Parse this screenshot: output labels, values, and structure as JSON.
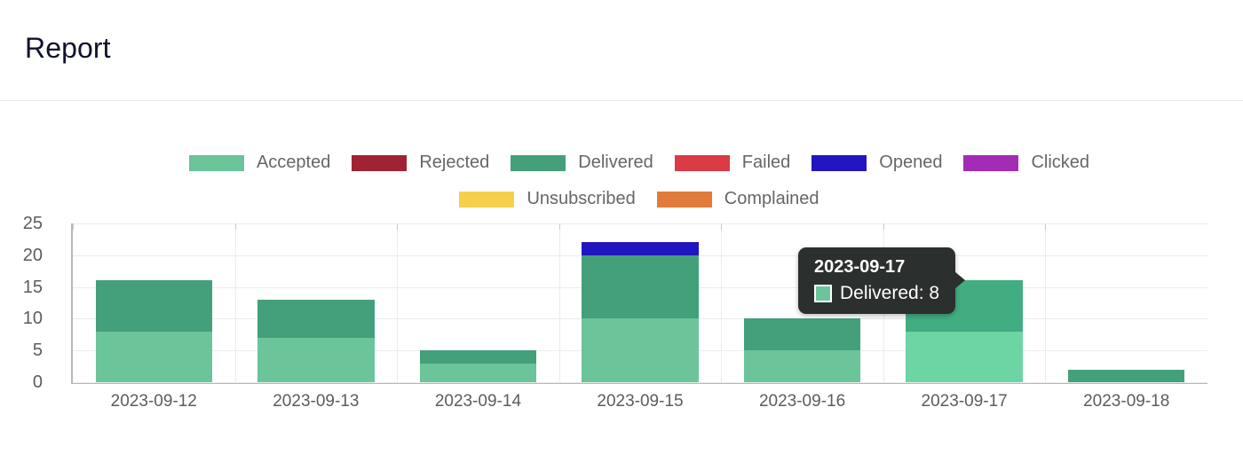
{
  "header": {
    "title": "Report"
  },
  "legend": {
    "rows": [
      [
        {
          "label": "Accepted",
          "color": "#6BC49A"
        },
        {
          "label": "Rejected",
          "color": "#A02334"
        },
        {
          "label": "Delivered",
          "color": "#43A07A"
        },
        {
          "label": "Failed",
          "color": "#DB3B45"
        },
        {
          "label": "Opened",
          "color": "#2116BF"
        },
        {
          "label": "Clicked",
          "color": "#A32BB5"
        }
      ],
      [
        {
          "label": "Unsubscribed",
          "color": "#F6D council"
        },
        {
          "label": "Complained",
          "color": "#E07B39"
        }
      ]
    ]
  },
  "chart_data": {
    "type": "bar",
    "stacked": true,
    "title": "Report",
    "xlabel": "",
    "ylabel": "",
    "ylim": [
      0,
      25
    ],
    "yticks": [
      0,
      5,
      10,
      15,
      20,
      25
    ],
    "grid": true,
    "legend_position": "top",
    "categories": [
      "2023-09-12",
      "2023-09-13",
      "2023-09-14",
      "2023-09-15",
      "2023-09-16",
      "2023-09-17",
      "2023-09-18"
    ],
    "series": [
      {
        "name": "Accepted",
        "color": "#6BC49A",
        "values": [
          8,
          7,
          3,
          10,
          5,
          8,
          0
        ]
      },
      {
        "name": "Rejected",
        "color": "#A02334",
        "values": [
          0,
          0,
          0,
          0,
          0,
          0,
          0
        ]
      },
      {
        "name": "Delivered",
        "color": "#43A07A",
        "values": [
          8,
          6,
          2,
          10,
          5,
          8,
          2
        ]
      },
      {
        "name": "Failed",
        "color": "#DB3B45",
        "values": [
          0,
          0,
          0,
          0,
          0,
          0,
          0
        ]
      },
      {
        "name": "Opened",
        "color": "#2116BF",
        "values": [
          0,
          0,
          0,
          2,
          0,
          0,
          0
        ]
      },
      {
        "name": "Clicked",
        "color": "#A32BB5",
        "values": [
          0,
          0,
          0,
          0,
          0,
          0,
          0
        ]
      },
      {
        "name": "Unsubscribed",
        "color": "#F6D04D",
        "values": [
          0,
          0,
          0,
          0,
          0,
          0,
          0
        ]
      },
      {
        "name": "Complained",
        "color": "#E07B39",
        "values": [
          0,
          0,
          0,
          0,
          0,
          0,
          0
        ]
      }
    ],
    "totals": [
      16,
      13,
      5,
      22,
      10,
      16,
      2
    ],
    "highlighted_category": "2023-09-17"
  },
  "tooltip": {
    "title": "2023-09-17",
    "series_label": "Delivered: 8",
    "swatch_color": "#6BC49A",
    "background": "#2b2f2d"
  }
}
